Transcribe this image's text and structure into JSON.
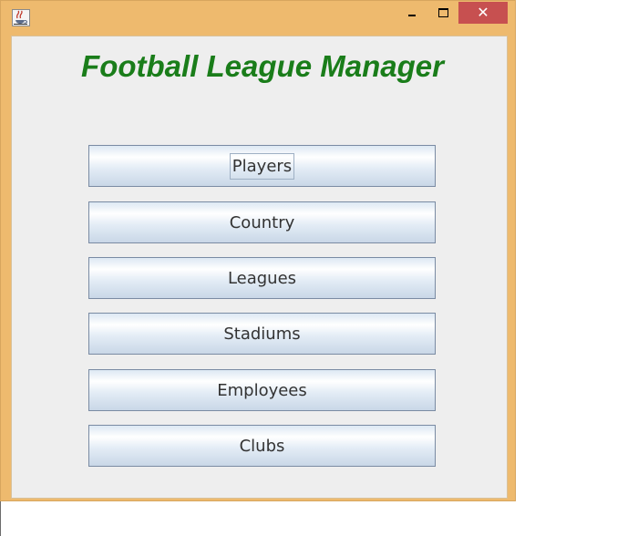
{
  "window": {
    "title": "",
    "icon": "java-coffee-cup-icon",
    "controls": {
      "minimize": "minimize-icon",
      "maximize": "maximize-icon",
      "close": "close-icon",
      "close_glyph": "✕"
    },
    "frame_color": "#eeba6e",
    "close_color": "#c75050"
  },
  "app": {
    "title": "Football League Manager",
    "title_color": "#1a7d1a"
  },
  "menu": {
    "focused_item": "Players",
    "items": [
      {
        "label": "Players"
      },
      {
        "label": "Country"
      },
      {
        "label": "Leagues"
      },
      {
        "label": "Stadiums"
      },
      {
        "label": "Employees"
      },
      {
        "label": "Clubs"
      }
    ]
  }
}
